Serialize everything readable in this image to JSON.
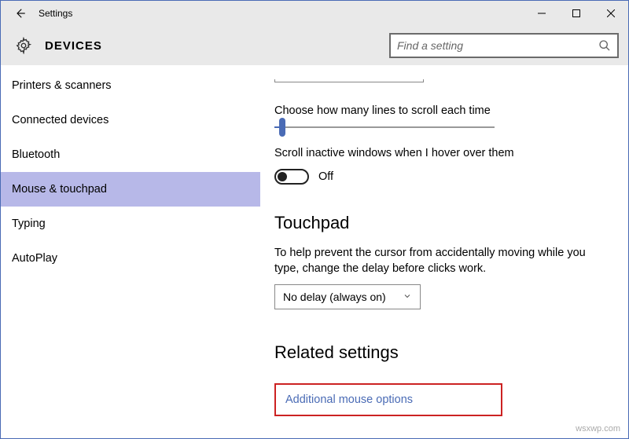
{
  "window": {
    "title": "Settings"
  },
  "header": {
    "title": "DEVICES",
    "search_placeholder": "Find a setting"
  },
  "sidebar": {
    "items": [
      {
        "label": "Printers & scanners",
        "selected": false
      },
      {
        "label": "Connected devices",
        "selected": false
      },
      {
        "label": "Bluetooth",
        "selected": false
      },
      {
        "label": "Mouse & touchpad",
        "selected": true
      },
      {
        "label": "Typing",
        "selected": false
      },
      {
        "label": "AutoPlay",
        "selected": false
      }
    ]
  },
  "main": {
    "scroll_lines_label": "Choose how many lines to scroll each time",
    "scroll_inactive_label": "Scroll inactive windows when I hover over them",
    "toggle_state": "Off",
    "touchpad": {
      "title": "Touchpad",
      "desc": "To help prevent the cursor from accidentally moving while you type, change the delay before clicks work.",
      "delay_value": "No delay (always on)"
    },
    "related": {
      "title": "Related settings",
      "link": "Additional mouse options"
    }
  },
  "watermark": "wsxwp.com"
}
